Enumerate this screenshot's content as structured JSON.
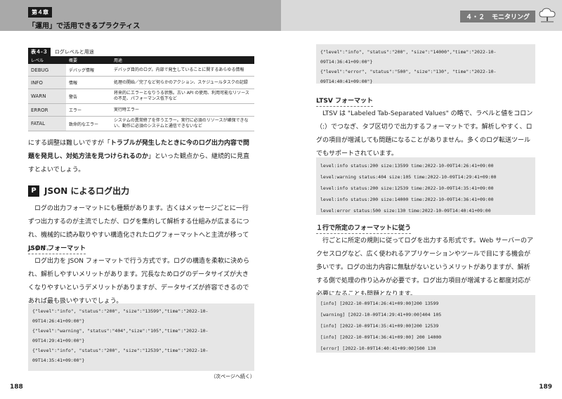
{
  "left_header": {
    "chapter_badge": "第４章",
    "chapter_title": "「運用」で活用できるプラクティス"
  },
  "right_header": {
    "section_num": "４・２",
    "section_title": "モニタリング",
    "icon": "cloud-tree-icon"
  },
  "table": {
    "tag": "表４-３",
    "caption": "ログレベルと用途",
    "headers": [
      "レベル",
      "概要",
      "用途"
    ],
    "rows": [
      [
        "DEBUG",
        "デバッグ情報",
        "デバッグ目的のログ。内部で発生していることに関するあらゆる情報"
      ],
      [
        "INFO",
        "情報",
        "処理の開始／完了など何らかのアクション、スケジュールタスクの記録"
      ],
      [
        "WARN",
        "警告",
        "将来的にエラーとなりうる状態。古い API の使用、利用可能なリソースの不足、パフォーマンス低下など"
      ],
      [
        "ERROR",
        "エラー",
        "実行時エラー"
      ],
      [
        "FATAL",
        "致命的なエラー",
        "システムの異常終了を伴うエラー。実行に必須のリソースが確保できない、動作に必須のシステムと通信できないなど"
      ]
    ]
  },
  "left": {
    "para1_pre": "にする調整は難しいですが「",
    "para1_bold": "トラブルが発生したときに今のログ出力内容で問題を発見し、対処方法を見つけられるのか",
    "para1_post": "」といった観点から、継続的に見直すとよいでしょう。",
    "h2": "JSON によるログ出力",
    "h2_icon": "P",
    "para2": "ログの出力フォーマットにも種類があります。古くはメッセージごとに一行ずつ出力するのが主流でしたが、ログを集約して解析する仕組みが広まるにつれ、機械的に読み取りやすい構造化されたログフォーマットへと主流が移っています。",
    "h3": "JSON フォーマット",
    "para3": "ログ出力を JSON フォーマットで行う方式です。ログの構造を柔軟に決められ、解析しやすいメリットがあります。冗長なためログのデータサイズが大きくなりやすいというデメリットがありますが、データサイズが許容できるのであれば最も扱いやすいでしょう。",
    "code": [
      "{\"level\":\"info\", \"status\":\"200\", \"size\":\"13599\",\"time\":\"2022-10-",
      "09T14:26:41+09:00\"}",
      "{\"level\":\"warning\", \"status\":\"404\",\"size\":\"105\",\"time\":\"2022-10-",
      "09T14:29:41+09:00\"}",
      "{\"level\":\"info\", \"status\":\"200\", \"size\":\"12539\",\"time\":\"2022-10-",
      "09T14:35:41+09:00\"}"
    ],
    "continue": "（次ページへ続く）",
    "page_number": "188"
  },
  "right": {
    "code1": [
      "{\"level\":\"info\", \"status\":\"200\", \"size\":\"14000\",\"time\":\"2022-10-",
      "09T14:36:41+09:00\"}",
      "{\"level\":\"error\", \"status\":\"500\", \"size\":\"130\", \"time\":\"2022-10-",
      "09T14:40:41+09:00\"}"
    ],
    "h3a": "LTSV フォーマット",
    "para1": "LTSV は \"Labeled Tab-Separated Values\" の略で、ラベルと値をコロン（:）でつなぎ、タブ区切りで出力するフォーマットです。解析しやすく、ログの項目が増減しても問題になることがありません。多くのログ転送ツールでもサポートされています。",
    "code2": [
      "level:info status:200 size:13599 time:2022-10-09T14:26:41+09:00",
      "level:warning status:404 size:105 time:2022-10-09T14:29:41+09:00",
      "level:info status:200 size:12539 time:2022-10-09T14:35:41+09:00",
      "level:info status:200 size:14000 time:2022-10-09T14:36:41+09:00",
      "level:error status:500 size:130 time:2022-10-09T14:40:41+09:00"
    ],
    "h3b": "１行で所定のフォーマットに従う",
    "para2": "行ごとに所定の規則に従ってログを出力する形式です。Web サーバーのアクセスログなど、広く使われるアプリケーションやツールで目にする機会が多いです。ログの出力内容に無駄がないというメリットがありますが、解析する側で処理の作り込みが必要です。ログ出力項目が増減すると都度対応が必要になることも問題となります。",
    "code3": [
      "[info] [2022-10-09T14:26:41+09:00]200 13599",
      "[warning] [2022-10-09T14:29:41+09:00]404 105",
      "[info] [2022-10-09T14:35:41+09:00]200 12539",
      "[info] [2022-10-09T14:36:41+09:00] 200 14000",
      "[error] [2022-10-09T14:40:41+09:00]500 130"
    ],
    "page_number": "189"
  }
}
